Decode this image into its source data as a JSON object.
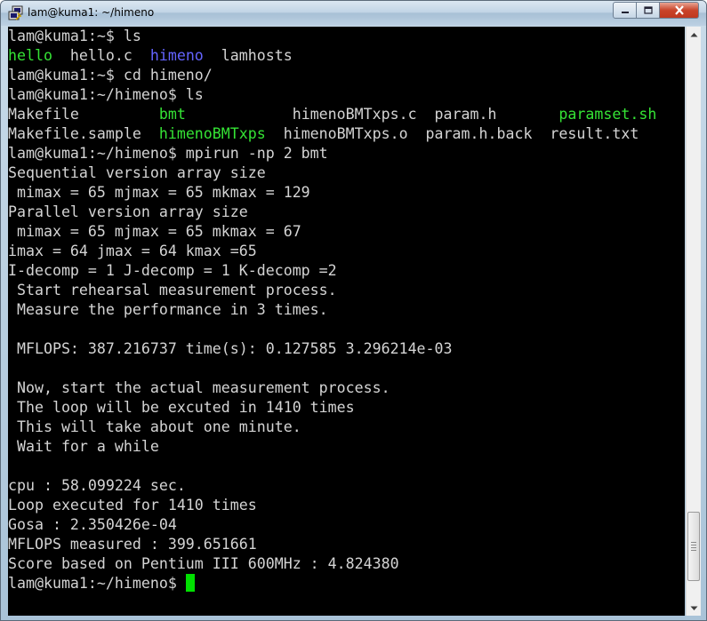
{
  "window": {
    "title": "lam@kuma1: ~/himeno",
    "app_icon": "putty-icon",
    "controls": {
      "minimize": "minimize-icon",
      "maximize": "maximize-icon",
      "close": "close-icon"
    }
  },
  "colors": {
    "background": "#000000",
    "text": "#d4d4d4",
    "green": "#35e335",
    "blue": "#6464ff",
    "cursor": "#00e000"
  },
  "terminal": {
    "lines": [
      {
        "segments": [
          {
            "text": "lam@kuma1:~$ ls"
          }
        ]
      },
      {
        "segments": [
          {
            "text": "hello",
            "color": "green"
          },
          {
            "text": "  hello.c  "
          },
          {
            "text": "himeno",
            "color": "blue"
          },
          {
            "text": "  lamhosts"
          }
        ]
      },
      {
        "segments": [
          {
            "text": "lam@kuma1:~$ cd himeno/"
          }
        ]
      },
      {
        "segments": [
          {
            "text": "lam@kuma1:~/himeno$ ls"
          }
        ]
      },
      {
        "segments": [
          {
            "text": "Makefile         "
          },
          {
            "text": "bmt",
            "color": "green"
          },
          {
            "text": "            himenoBMTxps.c  param.h       "
          },
          {
            "text": "paramset.sh",
            "color": "green"
          }
        ]
      },
      {
        "segments": [
          {
            "text": "Makefile.sample  "
          },
          {
            "text": "himenoBMTxps",
            "color": "green"
          },
          {
            "text": "  himenoBMTxps.o  param.h.back  result.txt"
          }
        ]
      },
      {
        "segments": [
          {
            "text": "lam@kuma1:~/himeno$ mpirun -np 2 bmt"
          }
        ]
      },
      {
        "segments": [
          {
            "text": "Sequential version array size"
          }
        ]
      },
      {
        "segments": [
          {
            "text": " mimax = 65 mjmax = 65 mkmax = 129"
          }
        ]
      },
      {
        "segments": [
          {
            "text": "Parallel version array size"
          }
        ]
      },
      {
        "segments": [
          {
            "text": " mimax = 65 mjmax = 65 mkmax = 67"
          }
        ]
      },
      {
        "segments": [
          {
            "text": "imax = 64 jmax = 64 kmax =65"
          }
        ]
      },
      {
        "segments": [
          {
            "text": "I-decomp = 1 J-decomp = 1 K-decomp =2"
          }
        ]
      },
      {
        "segments": [
          {
            "text": " Start rehearsal measurement process."
          }
        ]
      },
      {
        "segments": [
          {
            "text": " Measure the performance in 3 times."
          }
        ]
      },
      {
        "segments": [
          {
            "text": ""
          }
        ]
      },
      {
        "segments": [
          {
            "text": " MFLOPS: 387.216737 time(s): 0.127585 3.296214e-03"
          }
        ]
      },
      {
        "segments": [
          {
            "text": ""
          }
        ]
      },
      {
        "segments": [
          {
            "text": " Now, start the actual measurement process."
          }
        ]
      },
      {
        "segments": [
          {
            "text": " The loop will be excuted in 1410 times"
          }
        ]
      },
      {
        "segments": [
          {
            "text": " This will take about one minute."
          }
        ]
      },
      {
        "segments": [
          {
            "text": " Wait for a while"
          }
        ]
      },
      {
        "segments": [
          {
            "text": ""
          }
        ]
      },
      {
        "segments": [
          {
            "text": "cpu : 58.099224 sec."
          }
        ]
      },
      {
        "segments": [
          {
            "text": "Loop executed for 1410 times"
          }
        ]
      },
      {
        "segments": [
          {
            "text": "Gosa : 2.350426e-04"
          }
        ]
      },
      {
        "segments": [
          {
            "text": "MFLOPS measured : 399.651661"
          }
        ]
      },
      {
        "segments": [
          {
            "text": "Score based on Pentium III 600MHz : 4.824380"
          }
        ]
      },
      {
        "segments": [
          {
            "text": "lam@kuma1:~/himeno$ "
          }
        ],
        "cursor": true
      }
    ]
  },
  "scrollbar": {
    "position_fraction": 0.96,
    "up_icon": "scroll-up-arrow-icon",
    "down_icon": "scroll-down-arrow-icon"
  }
}
